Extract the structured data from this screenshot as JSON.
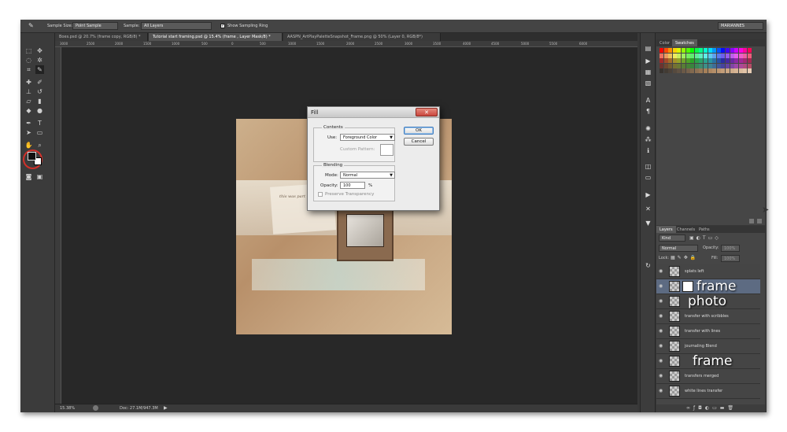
{
  "options_bar": {
    "sample_size_label": "Sample Size:",
    "sample_size_value": "Point Sample",
    "sample_label": "Sample:",
    "sample_value": "All Layers",
    "sampling_ring_label": "Show Sampling Ring",
    "workspace": "MARIANNES"
  },
  "tabs": [
    {
      "label": "Boes.psd @ 20.7% (frame copy, RGB/8) *"
    },
    {
      "label": "Tutorial start framing.psd @ 15.4% (frame , Layer Mask/8) *"
    },
    {
      "label": "AASPN_ArtPlayPaletteSnapshot_Frame.png @ 50% (Layer 0, RGB/8*)"
    }
  ],
  "ruler_ticks": [
    "3000",
    "2500",
    "2000",
    "1500",
    "1000",
    "500",
    "0",
    "500",
    "1000",
    "1500",
    "2000",
    "2500",
    "3000",
    "3500",
    "4000",
    "4500",
    "5000",
    "5500",
    "6000"
  ],
  "status": {
    "zoom": "15.38%",
    "doc": "Doc: 27.1M/947.3M"
  },
  "canvas_text": "this was part",
  "dialog": {
    "title": "Fill",
    "contents_label": "Contents",
    "use_label": "Use:",
    "use_value": "Foreground Color",
    "custom_pattern_label": "Custom Pattern:",
    "blending_label": "Blending",
    "mode_label": "Mode:",
    "mode_value": "Normal",
    "opacity_label": "Opacity:",
    "opacity_value": "100",
    "opacity_unit": "%",
    "preserve_label": "Preserve Transparency",
    "ok_label": "OK",
    "cancel_label": "Cancel"
  },
  "color_panel": {
    "tab_color": "Color",
    "tab_swatches": "Swatches"
  },
  "layers_panel": {
    "tab_layers": "Layers",
    "tab_channels": "Channels",
    "tab_paths": "Paths",
    "kind_label": "Kind",
    "blend_mode": "Normal",
    "opacity_label": "Opacity:",
    "opacity_value": "100%",
    "lock_label": "Lock:",
    "fill_label": "Fill:",
    "fill_value": "100%",
    "layers": [
      {
        "name": "splats left"
      },
      {
        "name": "frame",
        "selected": true
      },
      {
        "name": "photo"
      },
      {
        "name": "transfer with scribbles"
      },
      {
        "name": "transfer with lines"
      },
      {
        "name": "journaling Blend"
      },
      {
        "name": "frame"
      },
      {
        "name": "transfers merged"
      },
      {
        "name": "white lines transfer"
      }
    ]
  },
  "colors": {
    "accent_select": "#5d6b82",
    "foreground": "#111111",
    "background": "#ffffff",
    "dialog_close": "#c9463d"
  }
}
